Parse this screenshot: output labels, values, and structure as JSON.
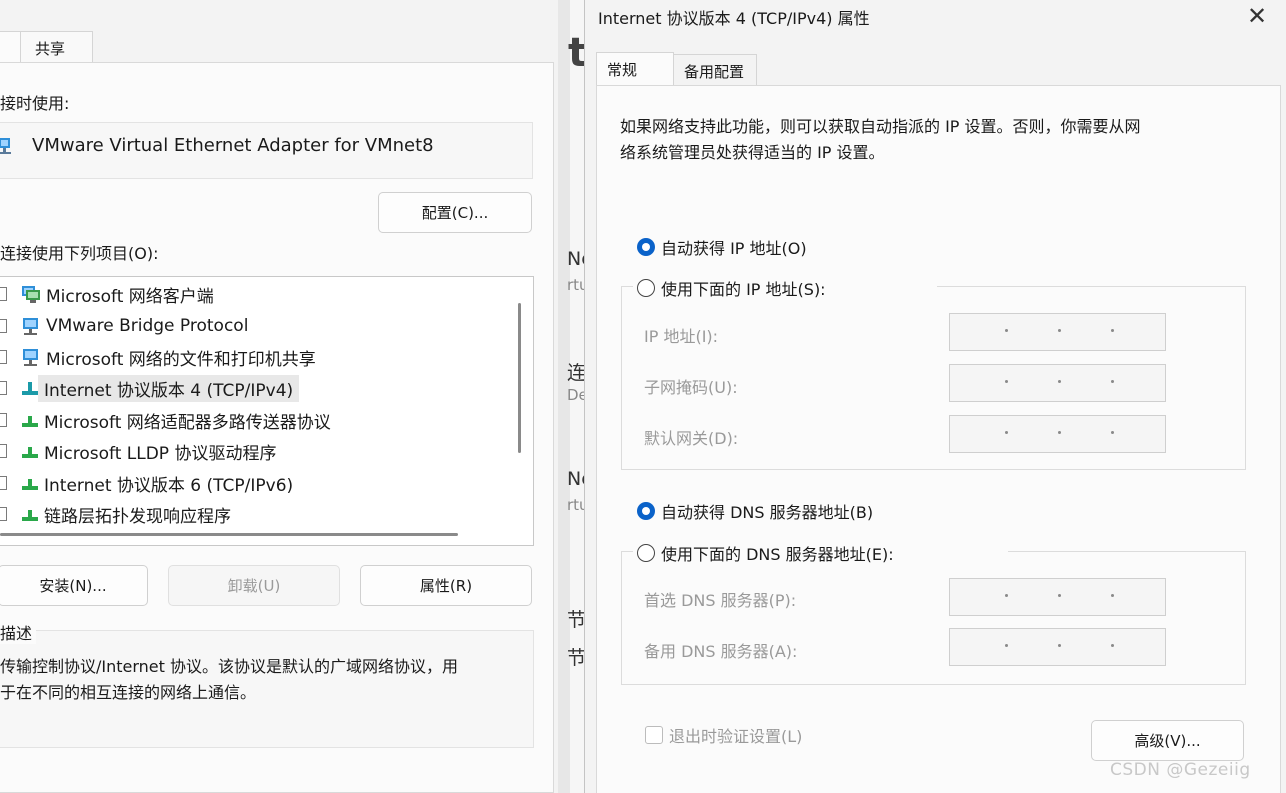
{
  "left_dialog": {
    "tab_share": "共享",
    "connect_using_label": "接时使用:",
    "adapter_name": "VMware Virtual Ethernet Adapter for VMnet8",
    "configure_button": "配置(C)...",
    "items_label": "连接使用下列项目(O):",
    "items": [
      {
        "label": "Microsoft 网络客户端",
        "icon": "network-client-icon"
      },
      {
        "label": "VMware Bridge Protocol",
        "icon": "network-client-icon"
      },
      {
        "label": "Microsoft 网络的文件和打印机共享",
        "icon": "network-client-icon"
      },
      {
        "label": "Internet 协议版本 4 (TCP/IPv4)",
        "icon": "protocol-icon",
        "selected": true
      },
      {
        "label": "Microsoft 网络适配器多路传送器协议",
        "icon": "protocol-icon"
      },
      {
        "label": "Microsoft LLDP 协议驱动程序",
        "icon": "protocol-icon"
      },
      {
        "label": "Internet 协议版本 6 (TCP/IPv6)",
        "icon": "protocol-icon"
      },
      {
        "label": "链路层拓扑发现响应程序",
        "icon": "protocol-icon"
      }
    ],
    "install_button": "安装(N)...",
    "uninstall_button": "卸载(U)",
    "properties_button": "属性(R)",
    "description_label": "描述",
    "description_text_line1": "传输控制协议/Internet 协议。该协议是默认的广域网络协议，用",
    "description_text_line2": "于在不同的相互连接的网络上通信。"
  },
  "background_window": {
    "fragments": [
      "te",
      "Ne",
      "rtu",
      "连",
      "De",
      "Ne",
      "rtu",
      "节",
      "节"
    ]
  },
  "right_dialog": {
    "title": "Internet 协议版本 4 (TCP/IPv4) 属性",
    "close_glyph": "✕",
    "tabs": [
      "常规",
      "备用配置"
    ],
    "info_line1": "如果网络支持此功能，则可以获取自动指派的 IP 设置。否则，你需要从网",
    "info_line2": "络系统管理员处获得适当的 IP 设置。",
    "auto_ip_label": "自动获得 IP 地址(O)",
    "manual_ip_label": "使用下面的 IP 地址(S):",
    "ip_fields": [
      "IP 地址(I):",
      "子网掩码(U):",
      "默认网关(D):"
    ],
    "auto_dns_label": "自动获得 DNS 服务器地址(B)",
    "manual_dns_label": "使用下面的 DNS 服务器地址(E):",
    "dns_fields": [
      "首选 DNS 服务器(P):",
      "备用 DNS 服务器(A):"
    ],
    "validate_label": "退出时验证设置(L)",
    "advanced_button": "高级(V)...",
    "selected_ip_mode": "auto",
    "selected_dns_mode": "auto"
  },
  "watermark": "CSDN @Gezeiig",
  "colors": {
    "accent": "#0a62c9"
  }
}
